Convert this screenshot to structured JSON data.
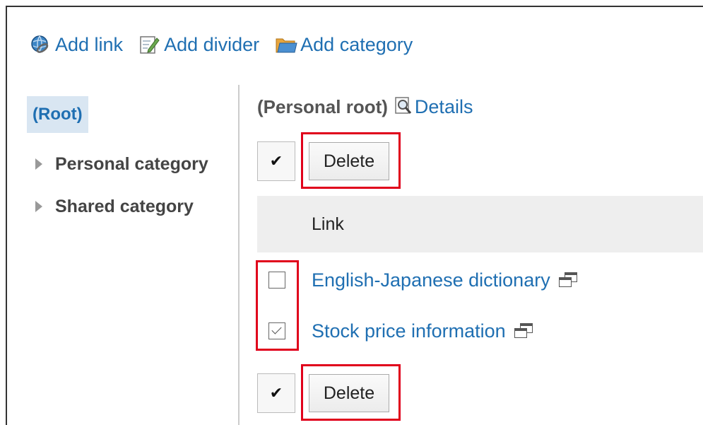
{
  "toolbar": {
    "add_link": "Add link",
    "add_divider": "Add divider",
    "add_category": "Add category"
  },
  "sidebar": {
    "root": "(Root)",
    "items": [
      {
        "label": "Personal category"
      },
      {
        "label": "Shared category"
      }
    ]
  },
  "main": {
    "folder_name": "(Personal root)",
    "details_label": "Details",
    "check_all_glyph": "✔",
    "delete_label": "Delete",
    "column_header": "Link",
    "links": [
      {
        "label": "English-Japanese dictionary",
        "checked": false
      },
      {
        "label": "Stock price information",
        "checked": true
      }
    ]
  },
  "colors": {
    "link": "#1f6fb2",
    "highlight": "#e0001b",
    "selected_bg": "#d9e6f2"
  }
}
